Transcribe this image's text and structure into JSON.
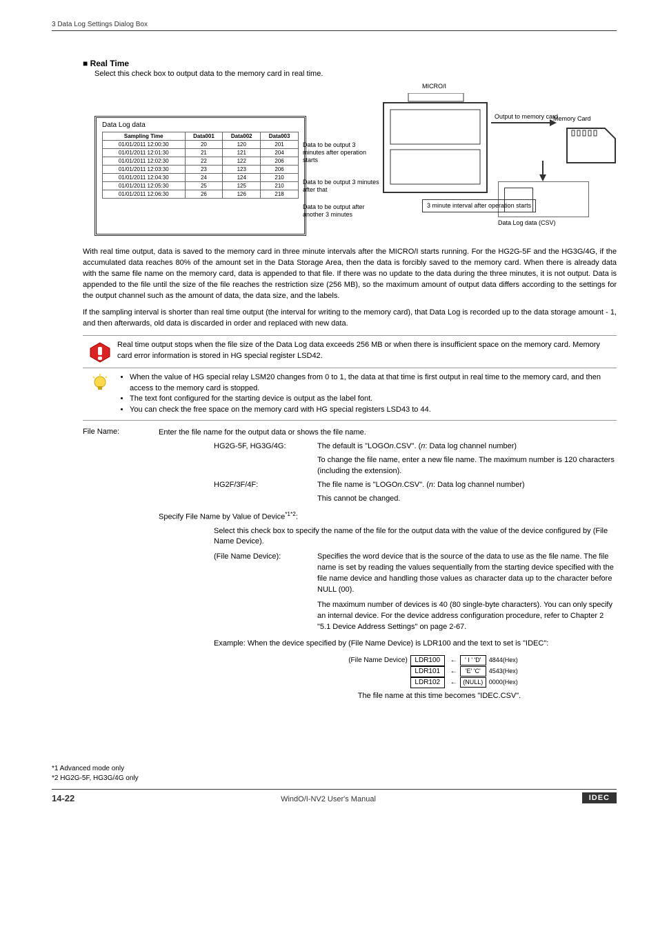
{
  "header": {
    "breadcrumb": "3 Data Log Settings Dialog Box"
  },
  "section": {
    "bullet": "■",
    "title": "Real Time",
    "subtitle": "Select this check box to output data to the memory card in real time."
  },
  "diagram": {
    "microi": "MICRO/I",
    "datalog_title": "Data Log data",
    "columns": [
      "Sampling Time",
      "Data001",
      "Data002",
      "Data003"
    ],
    "rows": [
      [
        "01/01/2011 12:00:30",
        "20",
        "120",
        "201"
      ],
      [
        "01/01/2011 12:01:30",
        "21",
        "121",
        "204"
      ],
      [
        "01/01/2011 12:02:30",
        "22",
        "122",
        "206"
      ],
      [
        "01/01/2011 12:03:30",
        "23",
        "123",
        "206"
      ],
      [
        "01/01/2011 12:04:30",
        "24",
        "124",
        "210"
      ],
      [
        "01/01/2011 12:05:30",
        "25",
        "125",
        "210"
      ],
      [
        "01/01/2011 12:06:30",
        "26",
        "126",
        "218"
      ]
    ],
    "note1": "Data to be output 3 minutes after operation starts",
    "note2": "Data to be output 3 minutes after that",
    "note3": "Data to be output after another 3 minutes",
    "output_to": "Output to memory card",
    "memory_card": "Memory Card",
    "interval": "3 minute interval after operation starts",
    "csv": "Data Log data (CSV)"
  },
  "para1": "With real time output, data is saved to the memory card in three minute intervals after the MICRO/I starts running. For the HG2G-5F and the HG3G/4G, if the accumulated data reaches 80% of the amount set in the Data Storage Area, then the data is forcibly saved to the memory card. When there is already data with the same file name on the memory card, data is appended to that file. If there was no update to the data during the three minutes, it is not output. Data is appended to the file until the size of the file reaches the restriction size (256 MB), so the maximum amount of output data differs according to the settings for the output channel such as the amount of data, the data size, and the labels.",
  "para2": "If the sampling interval is shorter than real time output (the interval for writing to the memory card), that Data Log is recorded up to the data storage amount - 1, and then afterwards, old data is discarded in order and replaced with new data.",
  "warn": "Real time output stops when the file size of the Data Log data exceeds 256 MB or when there is insufficient space on the memory card. Memory card error information is stored in HG special register LSD42.",
  "tips": [
    "When the value of HG special relay LSM20 changes from 0 to 1, the data at that time is first output in real time to the memory card, and then access to the memory card is stopped.",
    "The text font configured for the starting device is output as the label font.",
    "You can check the free space on the memory card with HG special registers LSD43 to 44."
  ],
  "fileName": {
    "label": "File Name:",
    "intro": "Enter the file name for the output data or shows the file name.",
    "m1_label": "HG2G-5F, HG3G/4G:",
    "m1_l1_a": "The default is \"LOGO",
    "m1_l1_b": ".CSV\". (",
    "m1_l1_c": ": Data log channel number)",
    "m1_l2": "To change the file name, enter a new file name. The maximum number is 120 characters (including the extension).",
    "m2_label": "HG2F/3F/4F:",
    "m2_l1_a": "The file name is \"LOGO",
    "m2_l1_b": ".CSV\". (",
    "m2_l1_c": ": Data log channel number)",
    "m2_l2": "This cannot be changed.",
    "spec_a": "Specify File Name by Value of Device",
    "spec_b": ":",
    "spec_desc": "Select this check box to specify the name of the file for the output data with the value of the device configured by (File Name Device).",
    "fnd_label": "(File Name Device):",
    "fnd_p1": "Specifies the word device that is the source of the data to use as the file name. The file name is set by reading the values sequentially from the starting device specified with the file name device and handling those values as character data up to the character before NULL (00).",
    "fnd_p2": "The maximum number of devices is 40 (80 single-byte characters). You can only specify an internal device. For the device address configuration procedure, refer to Chapter 2 \"5.1 Device Address Settings\" on page 2-67.",
    "example_intro": "Example:  When the device specified by (File Name Device) is LDR100 and the text to set is \"IDEC\":",
    "example_prefix": "(File Name Device)",
    "regs": [
      {
        "name": "LDR100",
        "chars": "' I ' 'D'",
        "hex": "4844(Hex)"
      },
      {
        "name": "LDR101",
        "chars": "'E' 'C'",
        "hex": "4543(Hex)"
      },
      {
        "name": "LDR102",
        "chars": "(NULL)",
        "hex": "0000(Hex)"
      }
    ],
    "example_result": "The file name at this time becomes \"IDEC.CSV\"."
  },
  "footnotes": {
    "f1": "*1  Advanced mode only",
    "f2": "*2  HG2G-5F, HG3G/4G only"
  },
  "footer": {
    "page": "14-22",
    "manual": "WindO/I-NV2 User's Manual",
    "brand": "IDEC"
  }
}
